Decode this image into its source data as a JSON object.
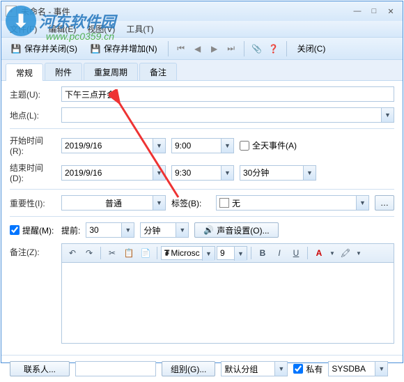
{
  "window": {
    "title": "未命名 - 事件"
  },
  "menu": {
    "file": "文件(F)",
    "edit": "编辑(E)",
    "view": "视图(V)",
    "tool": "工具(T)"
  },
  "toolbar": {
    "save_close": "保存并关闭(S)",
    "save_add": "保存并增加(N)",
    "close": "关闭(C)"
  },
  "tabs": {
    "general": "常规",
    "attachment": "附件",
    "recurrence": "重复周期",
    "notes": "备注"
  },
  "fields": {
    "subject_label": "主题(U):",
    "subject_value": "下午三点开会",
    "location_label": "地点(L):",
    "location_value": "",
    "start_label": "开始时间(R):",
    "start_date": "2019/9/16",
    "start_time": "9:00",
    "allday_label": "全天事件(A)",
    "end_label": "结束时间(D):",
    "end_date": "2019/9/16",
    "end_time": "9:30",
    "duration": "30分钟",
    "importance_label": "重要性(I):",
    "importance_value": "普通",
    "tag_label": "标签(B):",
    "tag_value": "无",
    "reminder_label": "提醒(M):",
    "reminder_before": "提前:",
    "reminder_value": "30",
    "reminder_unit": "分钟",
    "sound_btn": "声音设置(O)...",
    "memo_label": "备注(Z):",
    "font_name": "Microsc",
    "font_size": "9"
  },
  "bottom": {
    "contacts": "联系人...",
    "group": "组别(G)...",
    "group_value": "默认分组",
    "private": "私有",
    "owner": "SYSDBA"
  },
  "watermark": {
    "text": "河东软件园",
    "url": "www.pc0359.cn"
  }
}
